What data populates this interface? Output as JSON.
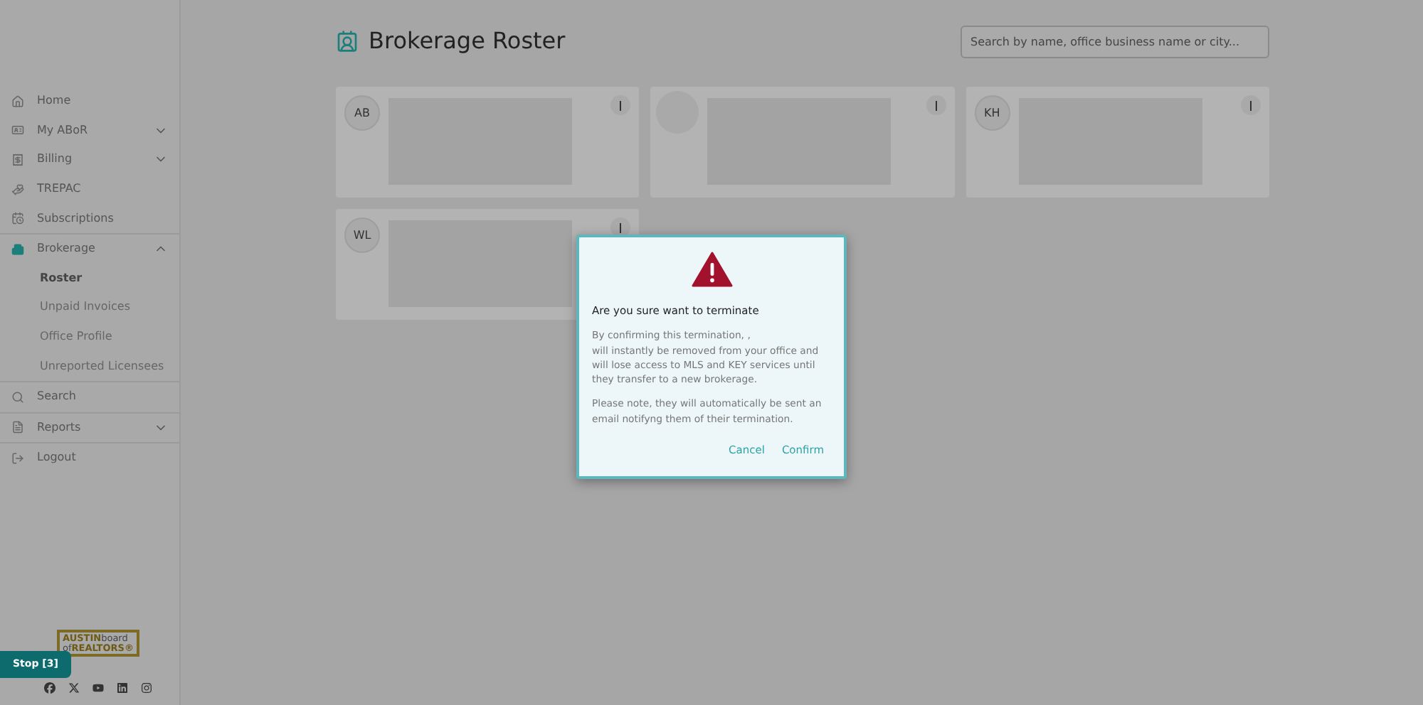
{
  "sidebar": {
    "items": [
      {
        "label": "Home"
      },
      {
        "label": "My ABoR",
        "expanded": false
      },
      {
        "label": "Billing",
        "expanded": false
      },
      {
        "label": "TREPAC"
      },
      {
        "label": "Subscriptions"
      },
      {
        "label": "Brokerage",
        "expanded": true,
        "children": [
          {
            "label": "Roster",
            "selected": true
          },
          {
            "label": "Unpaid Invoices",
            "selected": false
          },
          {
            "label": "Office Profile",
            "selected": false
          },
          {
            "label": "Unreported Licensees",
            "selected": false
          }
        ]
      },
      {
        "label": "Search"
      },
      {
        "label": "Reports",
        "expanded": false
      },
      {
        "label": "Logout"
      }
    ]
  },
  "logo": {
    "top_strong": "AUSTIN",
    "top": "board",
    "bottom": "of",
    "bottom_strong": "REALTORS®"
  },
  "stop_button": "Stop [3]",
  "socials": [
    {
      "kind": "facebook"
    },
    {
      "kind": "x"
    },
    {
      "kind": "youtube"
    },
    {
      "kind": "linkedin"
    },
    {
      "kind": "instagram"
    }
  ],
  "page": {
    "title": "Brokerage Roster",
    "search": {
      "placeholder": "Search by name, office business name or city..."
    }
  },
  "cards": [
    {
      "kind": "initials",
      "initials": "AB"
    },
    {
      "kind": "blank"
    },
    {
      "kind": "initials",
      "initials": "KH"
    },
    {
      "kind": "initials",
      "initials": "WL"
    }
  ],
  "dialog": {
    "title": "Are you sure want to terminate",
    "paragraphs": [
      "By confirming this termination, ,\nwill instantly be removed from your office and will lose access to MLS and KEY services until they transfer to a new brokerage.",
      "Please note, they will automatically be sent an email notifyng them of their termination."
    ],
    "buttons": [
      "Cancel",
      "Confirm"
    ]
  }
}
